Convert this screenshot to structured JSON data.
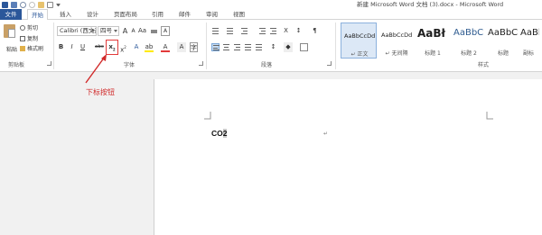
{
  "window": {
    "title": "新建 Microsoft Word 文档 (3).docx - Microsoft Word"
  },
  "tabs": [
    "文件",
    "开始",
    "插入",
    "设计",
    "页面布局",
    "引用",
    "邮件",
    "审阅",
    "视图"
  ],
  "active_tab": "开始",
  "clipboard": {
    "paste_label": "粘贴",
    "cut_label": "剪切",
    "copy_label": "复制",
    "format_painter_label": "格式刷",
    "group_label": "剪贴板"
  },
  "font": {
    "font_name": "Calibri (西文正",
    "font_size": "四号",
    "bold": "B",
    "italic": "I",
    "underline": "U",
    "strikethrough": "abc",
    "subscript": "x",
    "subscript_mark": "2",
    "superscript": "x",
    "superscript_mark": "2",
    "group_label": "字体"
  },
  "paragraph": {
    "group_label": "段落"
  },
  "styles": {
    "items": [
      {
        "sample": "AaBbCcDd",
        "name": "↵ 正文"
      },
      {
        "sample": "AaBbCcDd",
        "name": "↵ 无间隔"
      },
      {
        "sample": "AaBł",
        "name": "标题 1"
      },
      {
        "sample": "AaBbC",
        "name": "标题 2"
      },
      {
        "sample": "AaBbC",
        "name": "标题"
      },
      {
        "sample": "AaBbC",
        "name": "副标"
      }
    ],
    "group_label": "样式"
  },
  "document": {
    "text_main": "CO",
    "text_selected": "2",
    "paragraph_mark": "↵"
  },
  "annotation": {
    "label": "下标按钮",
    "color": "#d12a2a"
  },
  "colors": {
    "file_tab": "#2b579a",
    "accent": "#2b579a",
    "highlight_box": "#e23a3a"
  }
}
